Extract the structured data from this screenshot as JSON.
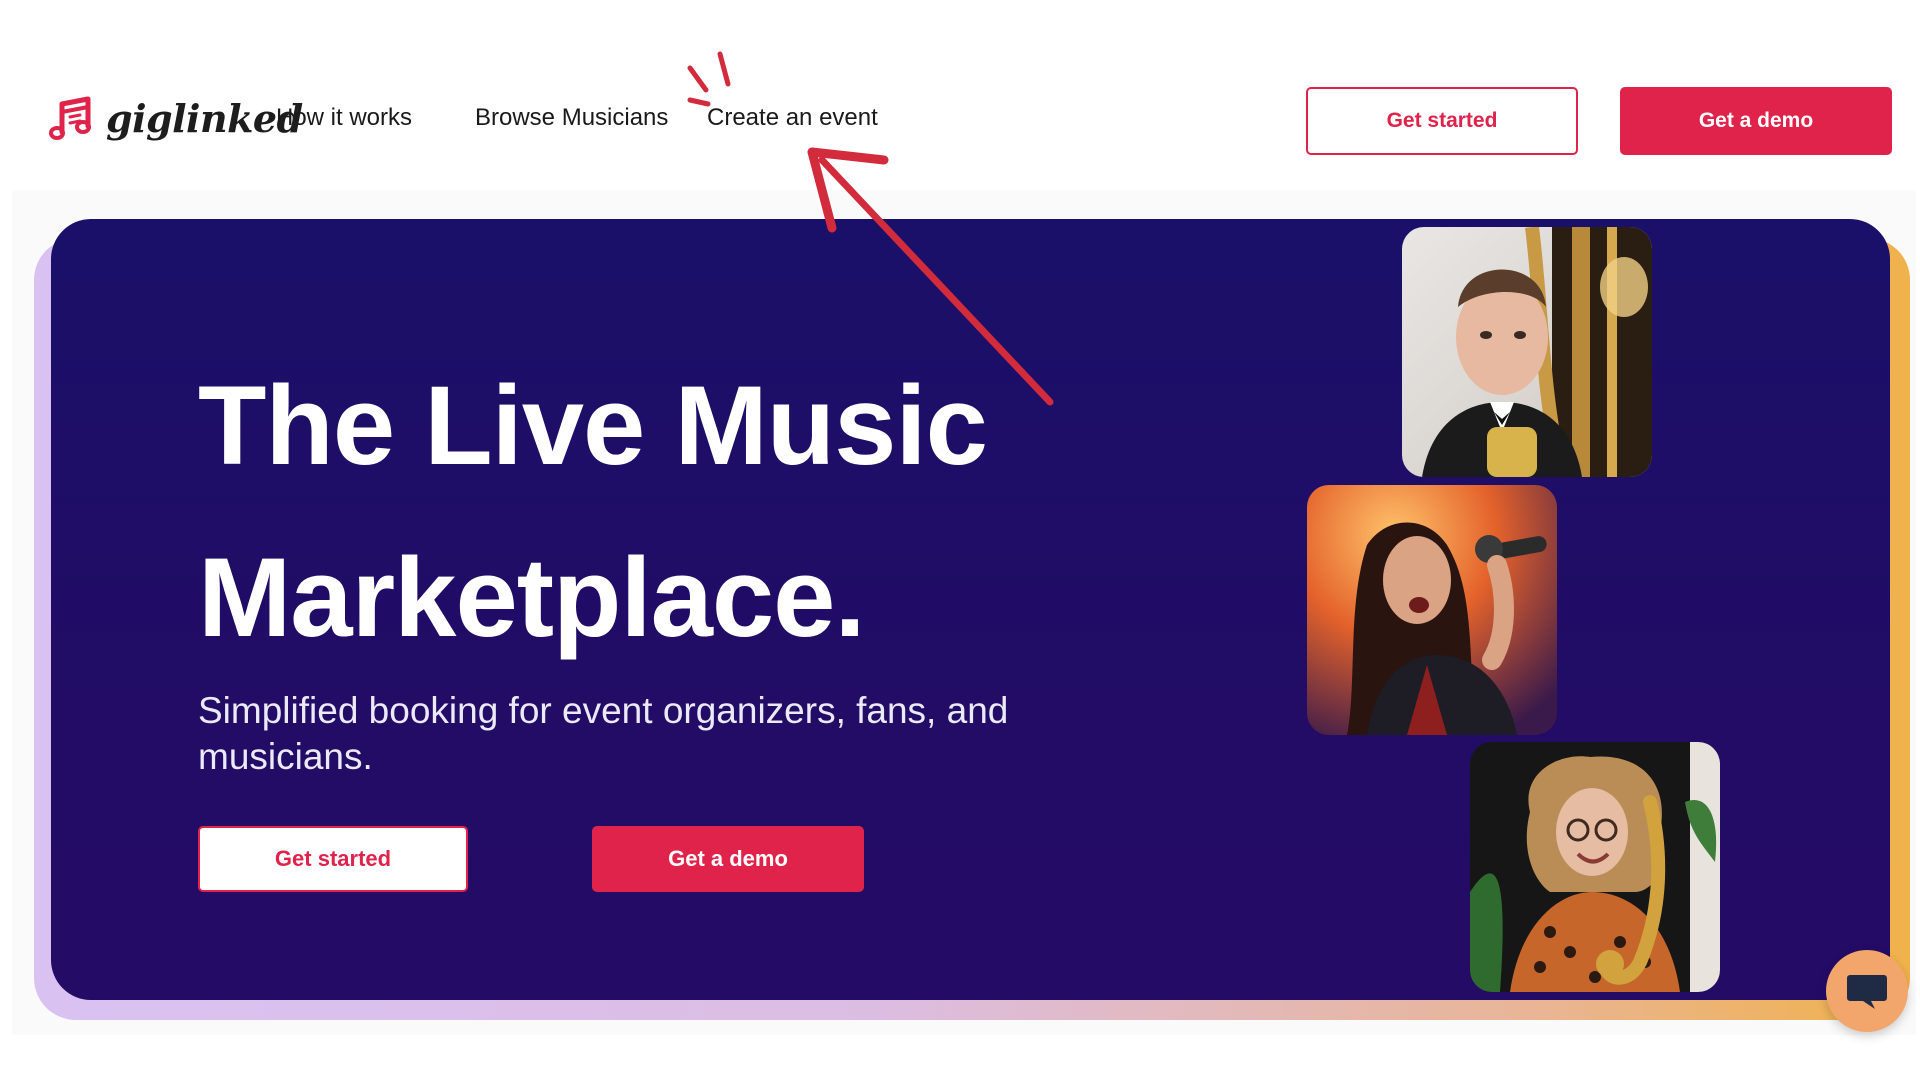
{
  "header": {
    "logo_text": "giglinked",
    "nav": {
      "how_it_works": "How it works",
      "browse_musicians": "Browse Musicians",
      "create_event": "Create an event"
    },
    "get_started_label": "Get started",
    "get_demo_label": "Get a demo"
  },
  "hero": {
    "title_line1": "The Live Music",
    "title_line2": "Marketplace.",
    "subtitle": "Simplified booking for event organizers, fans, and musicians.",
    "get_started_label": "Get started",
    "get_demo_label": "Get a demo"
  },
  "photos": [
    {
      "icon": "musician-harp-photo"
    },
    {
      "icon": "singer-microphone-photo"
    },
    {
      "icon": "saxophonist-photo"
    }
  ],
  "colors": {
    "brand_red": "#e0234b",
    "hero_bg": "#210c66",
    "chat_bubble": "#f3a66b"
  },
  "chat": {
    "icon": "chat-bubble-icon"
  }
}
